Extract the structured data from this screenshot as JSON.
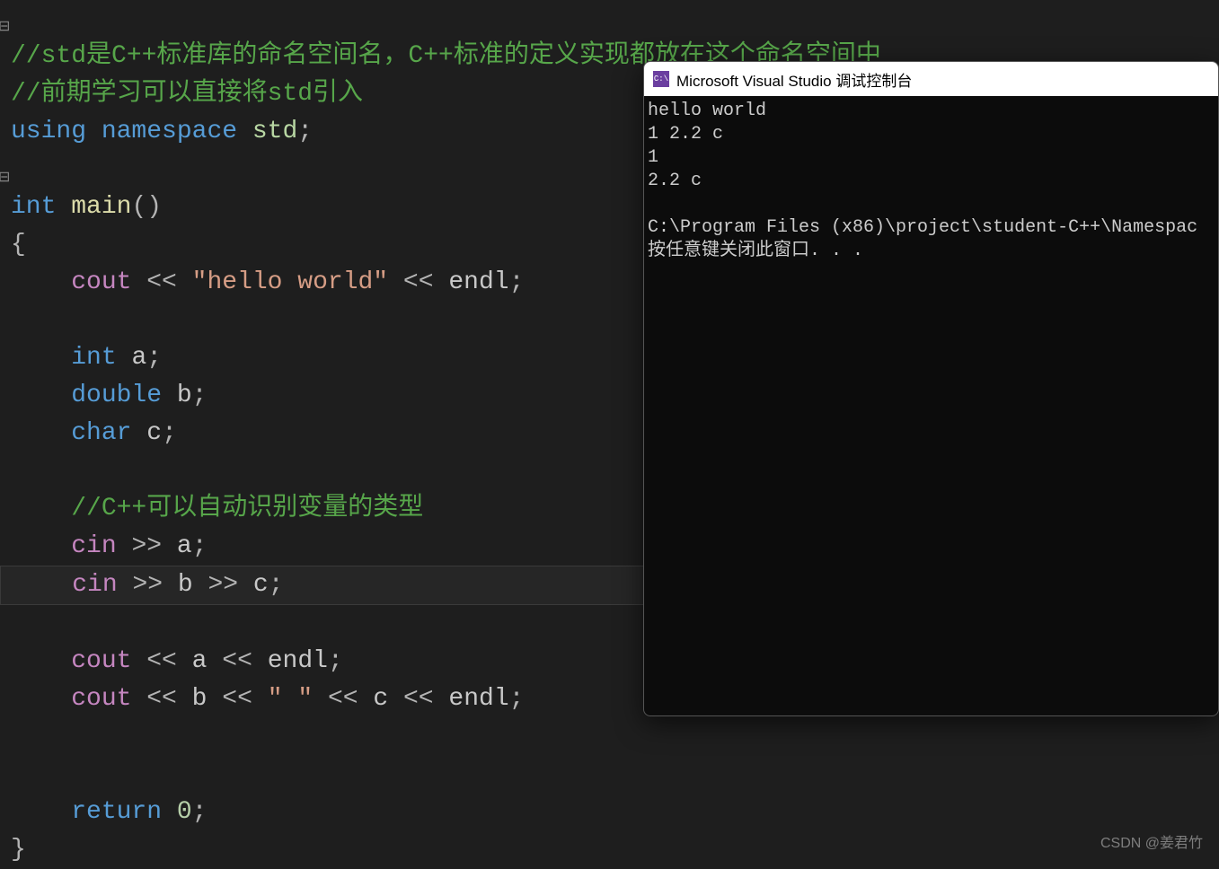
{
  "code": {
    "comment1": "//std是C++标准库的命名空间名，C++标准的定义实现都放在这个命名空间中",
    "comment2": "//前期学习可以直接将std引入",
    "using_kw": "using",
    "namespace_kw": "namespace",
    "std": "std",
    "int_kw": "int",
    "main": "main",
    "lbrace": "{",
    "rbrace": "}",
    "cout": "cout",
    "cin": "cin",
    "endl": "endl",
    "hello_str": "\"hello world\"",
    "decl_a_type": "int",
    "decl_a": "a",
    "decl_b_type": "double",
    "decl_b": "b",
    "decl_c_type": "char",
    "decl_c": "c",
    "comment3": "//C++可以自动识别变量的类型",
    "space_str": "\" \"",
    "return_kw": "return",
    "zero": "0",
    "lsh": "<<",
    "rsh": ">>",
    "semi": ";",
    "lparen": "(",
    "rparen": ")"
  },
  "console": {
    "title": "Microsoft Visual Studio 调试控制台",
    "icon_text": "C:\\",
    "lines": {
      "l1": "hello world",
      "l2": "1 2.2 c",
      "l3": "1",
      "l4": "2.2 c",
      "l5": "",
      "l6": "C:\\Program Files (x86)\\project\\student-C++\\Namespac",
      "l7": "按任意键关闭此窗口. . ."
    }
  },
  "watermark": "CSDN @姜君竹"
}
